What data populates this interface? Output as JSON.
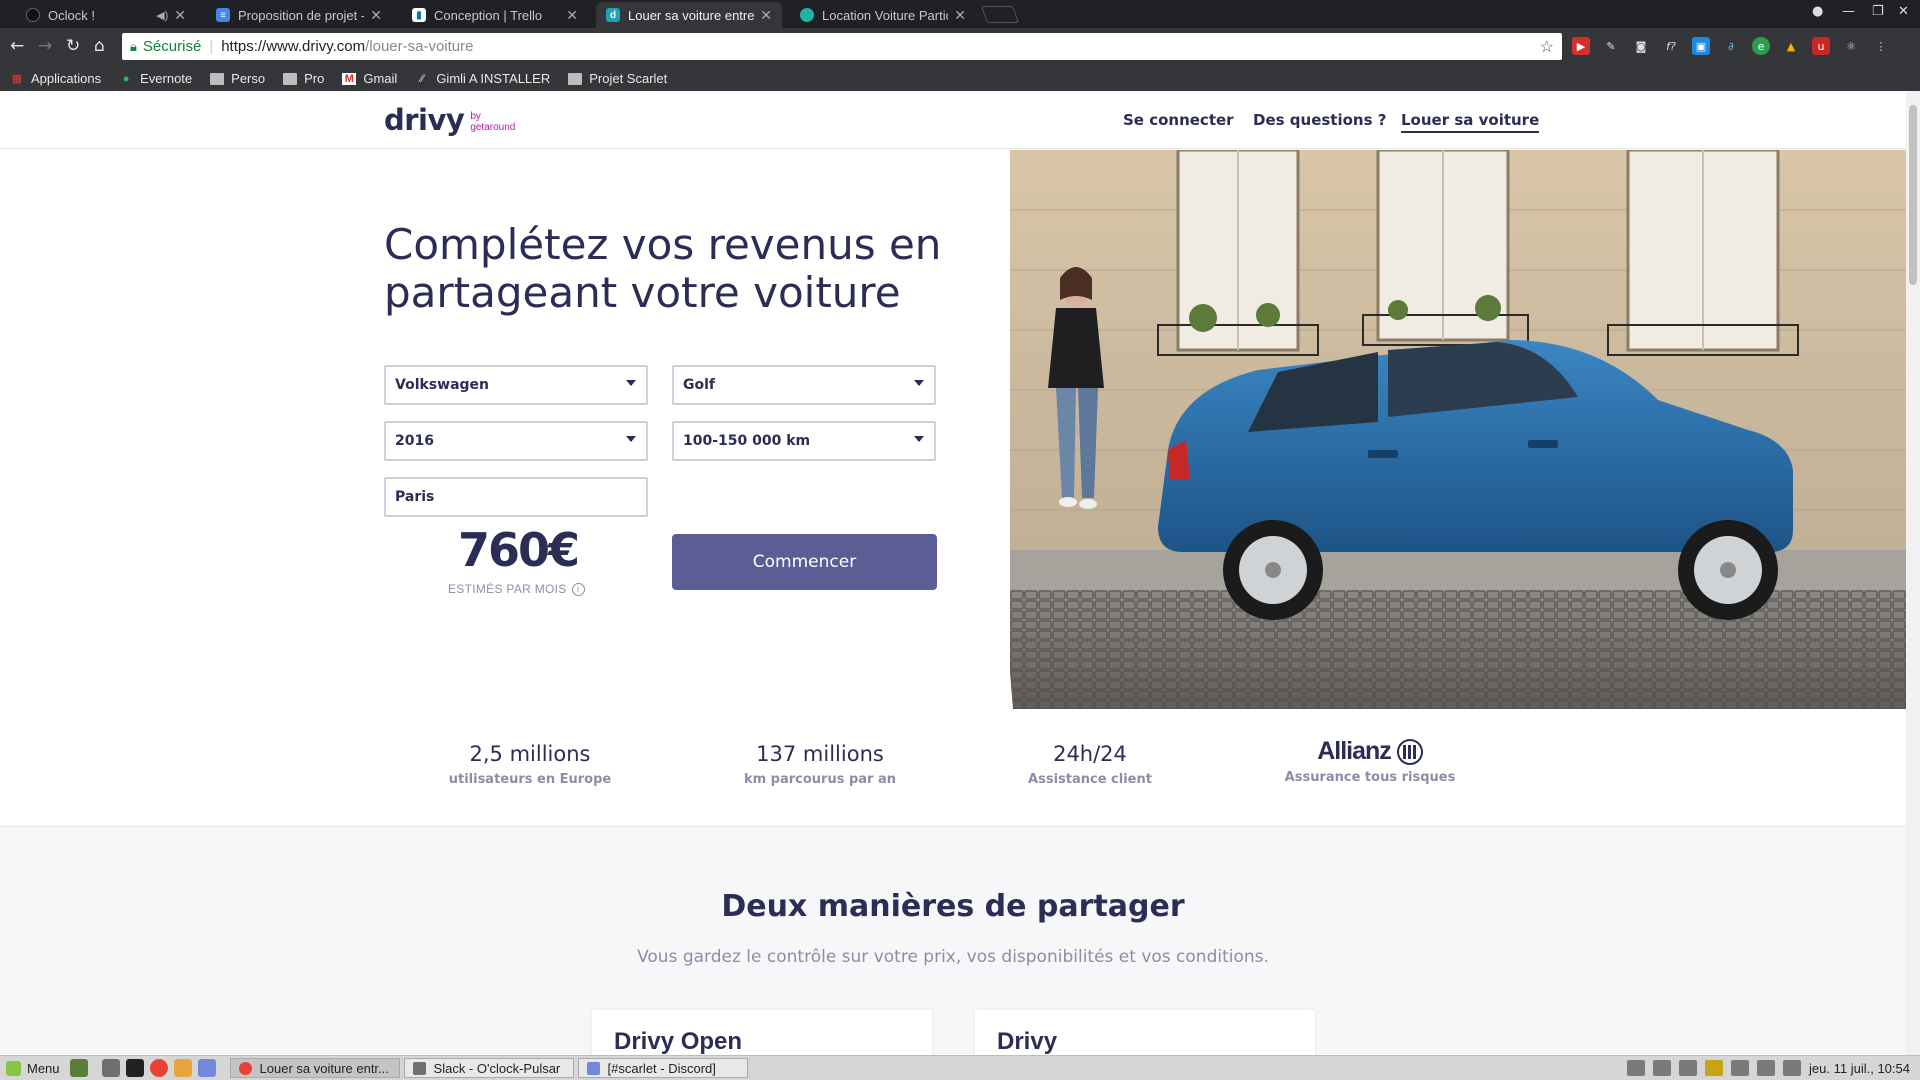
{
  "browser": {
    "tabs": [
      {
        "title": "Oclock !",
        "active": false
      },
      {
        "title": "Proposition de projet - G",
        "active": false
      },
      {
        "title": "Conception | Trello",
        "active": false
      },
      {
        "title": "Louer sa voiture entre p",
        "active": true
      },
      {
        "title": "Location Voiture Partic",
        "active": false
      }
    ],
    "address": {
      "secure_label": "Sécurisé",
      "url_host": "https://www.drivy.com",
      "url_path": "/louer-sa-voiture"
    },
    "bookmarks": [
      {
        "label": "Applications",
        "icon": "apps-grid-icon"
      },
      {
        "label": "Evernote",
        "icon": "evernote-icon"
      },
      {
        "label": "Perso",
        "icon": "folder-icon"
      },
      {
        "label": "Pro",
        "icon": "folder-icon"
      },
      {
        "label": "Gmail",
        "icon": "gmail-icon"
      },
      {
        "label": "Gimli A INSTALLER",
        "icon": "link-icon"
      },
      {
        "label": "Projet Scarlet",
        "icon": "folder-icon"
      }
    ]
  },
  "site": {
    "logo": {
      "word": "drivy",
      "by": "by",
      "partner": "getaround"
    },
    "nav": {
      "login": "Se connecter",
      "questions": "Des questions ?",
      "rent": "Louer sa voiture"
    },
    "hero": {
      "headline": "Complétez vos revenus en partageant votre voiture",
      "form": {
        "brand": "Volkswagen",
        "model": "Golf",
        "year": "2016",
        "mileage": "100-150 000 km",
        "city": "Paris"
      },
      "estimate": {
        "amount": "760€",
        "caption": "ESTIMÉS PAR MOIS"
      },
      "cta": "Commencer"
    },
    "stats": [
      {
        "value": "2,5 millions",
        "label": "utilisateurs en Europe"
      },
      {
        "value": "137 millions",
        "label": "km parcourus par an"
      },
      {
        "value": "24h/24",
        "label": "Assistance client"
      },
      {
        "value": "Allianz",
        "label": "Assurance tous risques"
      }
    ],
    "section": {
      "title": "Deux manières de partager",
      "subtitle": "Vous gardez le contrôle sur votre prix, vos disponibilités et vos conditions."
    },
    "cards": [
      {
        "title": "Drivy Open"
      },
      {
        "title": "Drivy"
      }
    ]
  },
  "taskbar": {
    "menu": "Menu",
    "tasks": [
      {
        "title": "Louer sa voiture entr...",
        "active": true
      },
      {
        "title": "Slack - O'clock-Pulsar",
        "active": false
      },
      {
        "title": "[#scarlet - Discord]",
        "active": false
      }
    ],
    "clock": "jeu. 11 juil., 10:54"
  },
  "colors": {
    "brand_navy": "#2b2d54",
    "cta": "#5a5e95",
    "accent_purple": "#b31fa5",
    "car_blue": "#2a6fa8"
  }
}
